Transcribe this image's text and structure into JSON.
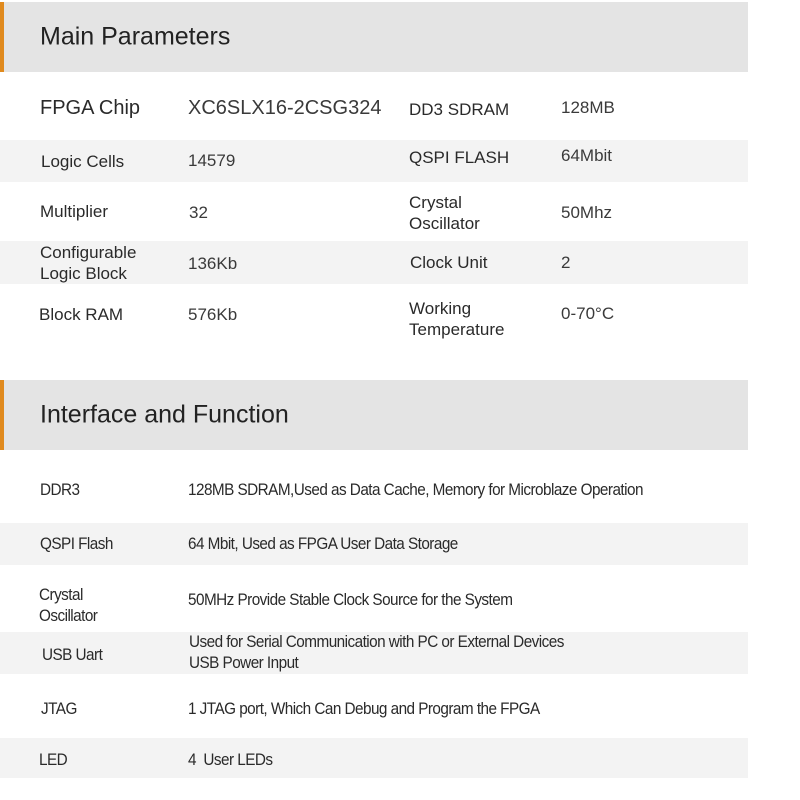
{
  "accent_color": "#e08a1e",
  "main_parameters": {
    "title": "Main Parameters",
    "rows": [
      {
        "label_left": "FPGA Chip",
        "value_left": "XC6SLX16-2CSG324",
        "label_right": "DD3 SDRAM",
        "value_right": "128MB"
      },
      {
        "label_left": "Logic Cells",
        "value_left": "14579",
        "label_right": "QSPI FLASH",
        "value_right": "64Mbit"
      },
      {
        "label_left": "Multiplier",
        "value_left": "32",
        "label_right_line1": "Crystal",
        "label_right_line2": "Oscillator",
        "value_right": "50Mhz"
      },
      {
        "label_left_line1": "Configurable",
        "label_left_line2": "Logic Block",
        "value_left": "136Kb",
        "label_right": "Clock Unit",
        "value_right": "2"
      },
      {
        "label_left": "Block RAM",
        "value_left": "576Kb",
        "label_right_line1": "Working",
        "label_right_line2": "Temperature",
        "value_right": "0-70°C"
      }
    ]
  },
  "interface_function": {
    "title": "Interface and Function",
    "rows": [
      {
        "label": "DDR3",
        "description": "128MB SDRAM,Used as Data Cache, Memory for Microblaze Operation"
      },
      {
        "label": "QSPI Flash",
        "description": "64 Mbit, Used as FPGA User Data Storage"
      },
      {
        "label_line1": "Crystal",
        "label_line2": "Oscillator",
        "description": "50MHz Provide Stable Clock Source for the System"
      },
      {
        "label": "USB Uart",
        "description_line1": "Used for Serial Communication with PC or External Devices",
        "description_line2": "USB Power Input"
      },
      {
        "label": "JTAG",
        "description": "1 JTAG port, Which Can Debug and Program the FPGA"
      },
      {
        "label": "LED",
        "description": "4  User LEDs"
      }
    ]
  }
}
